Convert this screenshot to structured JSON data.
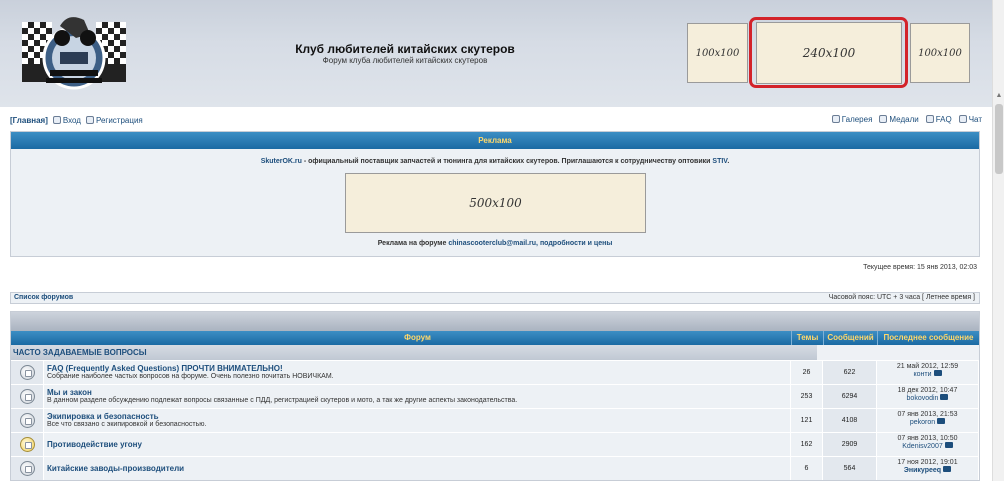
{
  "header": {
    "site_title": "Клуб любителей китайских скутеров",
    "site_desc": "Форум клуба любителей китайских скутеров",
    "banners": [
      "100x100",
      "240x100",
      "100x100"
    ]
  },
  "nav": {
    "home": "[Главная]",
    "login": "Вход",
    "register": "Регистрация",
    "gallery": "Галерея",
    "medals": "Медали",
    "faq": "FAQ",
    "chat": "Чат"
  },
  "ad": {
    "heading": "Реклама",
    "brand": "SkuterOK.ru",
    "line1": " - официальный поставщик запчастей и тюнинга для китайских скутеров. Приглашаются к сотрудничеству оптовики ",
    "stiv": "STIV",
    "line1_end": ".",
    "banner": "500x100",
    "line2_prefix": "Реклама на форуме ",
    "line2_link": "chinascooterclub@mail.ru, подробности и цены"
  },
  "current_time": "Текущее время: 15 янв 2013, 02:03",
  "forums_bar": {
    "left": "Список форумов",
    "right": "Часовой пояс: UTC + 3 часа [ Летнее время ]"
  },
  "table": {
    "headers": {
      "forum": "Форум",
      "topics": "Темы",
      "posts": "Сообщений",
      "last": "Последнее сообщение"
    },
    "category": "ЧАСТО ЗАДАВАЕМЫЕ ВОПРОСЫ",
    "rows": [
      {
        "title": "FAQ (Frequently Asked Questions) ПРОЧТИ ВНИМАТЕЛЬНО!",
        "desc": "Собрание наиболее частых вопросов на форуме. Очень полезно почитать НОВИЧКАМ.",
        "topics": "26",
        "posts": "622",
        "last_date": "21 май 2012, 12:59",
        "last_user": "конти"
      },
      {
        "title": "Мы и закон",
        "desc": "В данном разделе обсуждению подлежат вопросы связанные с ПДД, регистрацией скутеров и мото, а так же другие аспекты законодательства.",
        "topics": "253",
        "posts": "6294",
        "last_date": "18 дек 2012, 10:47",
        "last_user": "bokovodin"
      },
      {
        "title": "Экипировка и безопасность",
        "desc": "Все что связано с экипировкой и безопасностью.",
        "topics": "121",
        "posts": "4108",
        "last_date": "07 янв 2013, 21:53",
        "last_user": "pekoron"
      },
      {
        "title": "Противодействие угону",
        "desc": "",
        "topics": "162",
        "posts": "2909",
        "last_date": "07 янв 2013, 10:50",
        "last_user": "Kdenisv2007"
      },
      {
        "title": "Китайские заводы-производители",
        "desc": "",
        "topics": "6",
        "posts": "564",
        "last_date": "17 ноя 2012, 19:01",
        "last_user": "Эникурееq"
      }
    ]
  }
}
